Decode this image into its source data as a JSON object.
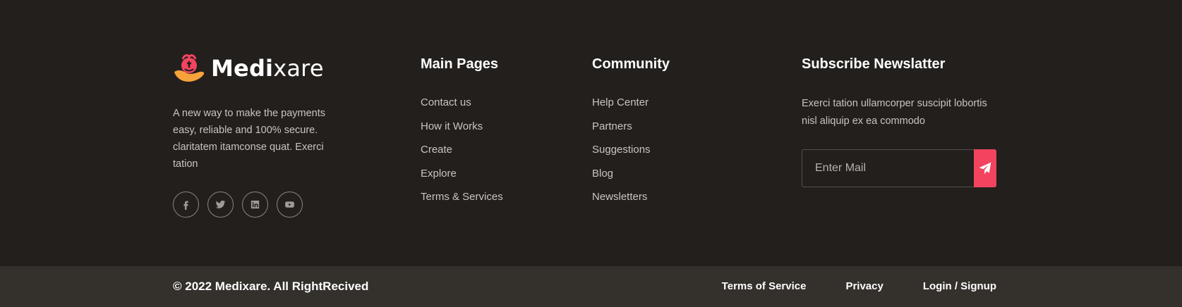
{
  "brand": {
    "name_bold": "Medi",
    "name_rest": "xare",
    "description": "A new way to make the payments easy, reliable and 100% secure. claritatem itamconse quat. Exerci tation",
    "logo_colors": {
      "primary": "#f2445f",
      "secondary": "#f7a23b"
    },
    "socials": [
      {
        "icon": "facebook-icon"
      },
      {
        "icon": "twitter-icon"
      },
      {
        "icon": "linkedin-icon"
      },
      {
        "icon": "youtube-icon"
      }
    ]
  },
  "main_pages": {
    "heading": "Main Pages",
    "links": [
      "Contact us",
      "How it Works",
      "Create",
      "Explore",
      "Terms & Services"
    ]
  },
  "community": {
    "heading": "Community",
    "links": [
      "Help Center",
      "Partners",
      "Suggestions",
      "Blog",
      "Newsletters"
    ]
  },
  "newsletter": {
    "heading": "Subscribe Newslatter",
    "description": "Exerci tation ullamcorper suscipit lobortis nisl aliquip ex ea commodo",
    "input_placeholder": "Enter Mail",
    "send_icon": "paper-plane-icon",
    "accent": "#f2445f"
  },
  "bottom_bar": {
    "copyright": "© 2022 Medixare. All RightRecived",
    "links": [
      "Terms of Service",
      "Privacy",
      "Login / Signup"
    ]
  },
  "colors": {
    "background": "#231f1c",
    "bottom_background": "#34302c",
    "text_muted": "#c9c4bf"
  }
}
